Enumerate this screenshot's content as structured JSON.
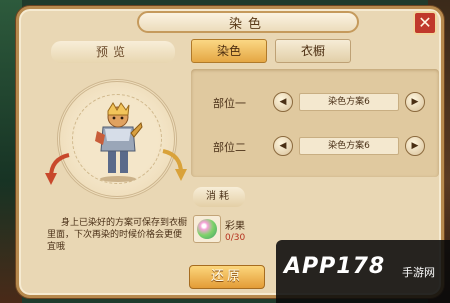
{
  "window": {
    "title": "染色",
    "close_symbol": "✕"
  },
  "preview": {
    "header": "预览",
    "description": "身上已染好的方案可保存到衣橱里面，下次再染的时候价格会更便宜哦"
  },
  "tabs": [
    {
      "label": "染色",
      "active": true
    },
    {
      "label": "衣橱",
      "active": false
    }
  ],
  "parts": [
    {
      "label": "部位一",
      "scheme": "染色方案6"
    },
    {
      "label": "部位二",
      "scheme": "染色方案6"
    }
  ],
  "consume": {
    "header": "消耗",
    "item_name": "彩果",
    "item_count": "0/30",
    "item_icon": "rainbow-fruit-icon"
  },
  "actions": {
    "restore_label": "还原"
  },
  "watermark": {
    "text": "APP178",
    "sub": "手游网"
  },
  "colors": {
    "panel_bg": "#e9d7b4",
    "accent_gold": "#e5a744",
    "close_red": "#c0392b",
    "count_red": "#b5321f"
  }
}
